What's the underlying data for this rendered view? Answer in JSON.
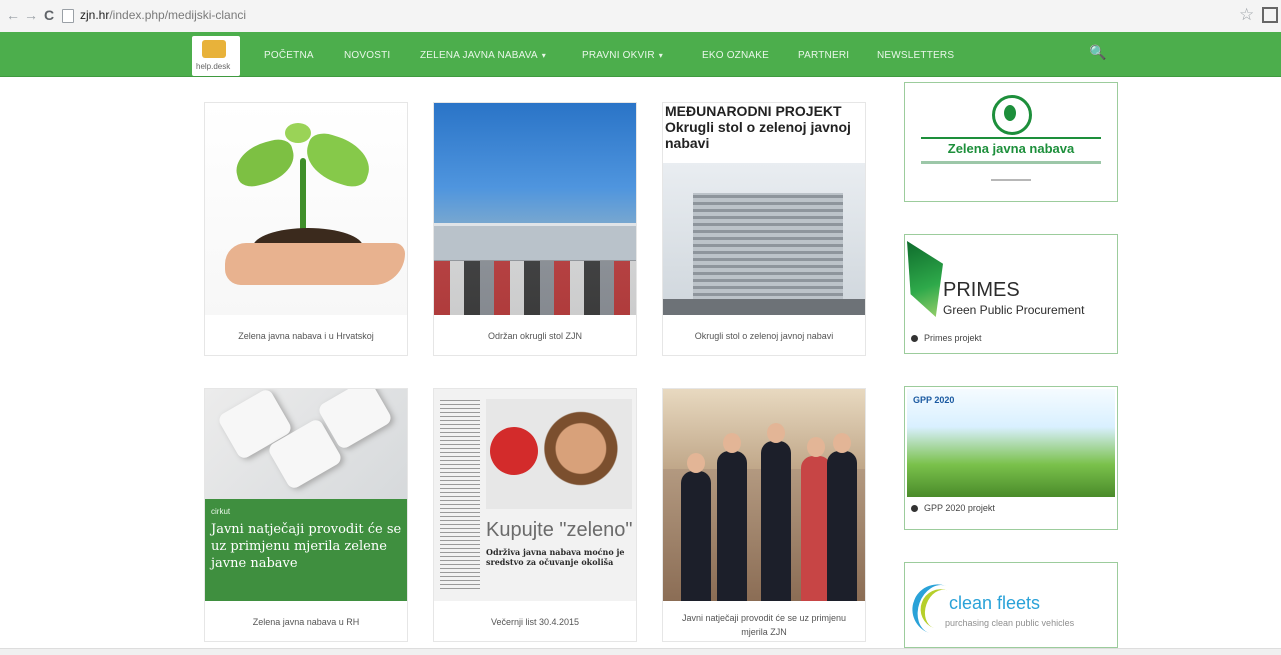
{
  "browser": {
    "url_domain": "zjn.hr",
    "url_path": "/index.php/medijski-clanci"
  },
  "nav": {
    "logo_label": "help.desk",
    "items": [
      {
        "label": "POČETNA"
      },
      {
        "label": "NOVOSTI"
      },
      {
        "label": "ZELENA JAVNA NABAVA",
        "caret": "▾"
      },
      {
        "label": "PRAVNI OKVIR",
        "caret": "▾"
      },
      {
        "label": "EKO OZNAKE"
      },
      {
        "label": "PARTNERI"
      },
      {
        "label": "NEWSLETTERS"
      }
    ],
    "search_icon": "🔍"
  },
  "cards": [
    {
      "caption": "Zelena javna nabava i u Hrvatskoj"
    },
    {
      "caption": "Održan okrugli stol ZJN"
    },
    {
      "caption": "Okrugli stol o zelenoj javnoj nabavi",
      "image_title": "MEĐUNARODNI PROJEKT Okrugli stol o zelenoj javnoj nabavi"
    },
    {
      "caption": "Zelena javna nabava u RH",
      "overlay_kicker": "cirkut",
      "overlay_title": "Javni natječaji provodit će se uz primjenu mjerila zelene javne nabave"
    },
    {
      "caption": "Večernji list 30.4.2015",
      "paper_headline": "Kupujte \"zeleno\"",
      "paper_subheadline": "Održiva javna nabava moćno je sredstvo za očuvanje okoliša"
    },
    {
      "caption": "Javni natječaji provodit će se uz primjenu mjerila ZJN"
    }
  ],
  "sidebar": {
    "zjn_title": "Zelena javna nabava",
    "primes_title": "PRIMES",
    "primes_sub": "Green Public Procurement",
    "primes_link": "Primes projekt",
    "gpp_badge": "GPP 2020",
    "gpp_link": "GPP 2020 projekt",
    "cf_title": "clean fleets",
    "cf_sub": "purchasing clean public vehicles"
  }
}
